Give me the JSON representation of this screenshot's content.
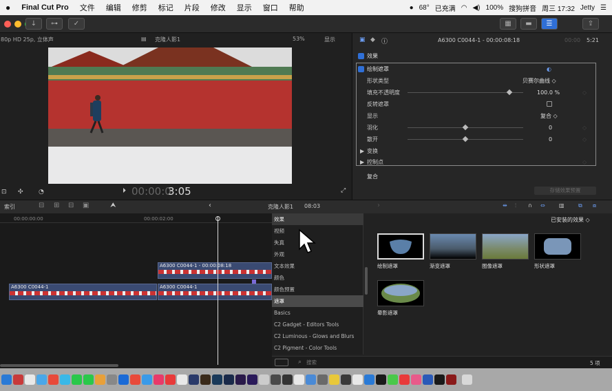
{
  "menubar": {
    "apple": "",
    "app_name": "Final Cut Pro",
    "menus": [
      "文件",
      "编辑",
      "修剪",
      "标记",
      "片段",
      "修改",
      "显示",
      "窗口",
      "帮助"
    ],
    "status": {
      "temp": "68°",
      "charging": "已充满",
      "battery": "100%",
      "input_method": "搜狗拼音",
      "datetime": "周三 17:32",
      "user": "Jetty"
    }
  },
  "viewer": {
    "format": "80p HD 25p, 立体声",
    "project_name": "克隆人影1",
    "zoom": "53%",
    "display_menu": "显示",
    "timecode_dim": "00:00:0",
    "timecode_bright": "3:05"
  },
  "inspector": {
    "clip_title": "A6300 C0044-1 - 00:00:08:18",
    "duration_dim": "00:00",
    "duration_bright": "5:21",
    "section_effects": "效果",
    "effect_name": "绘制遮罩",
    "params": [
      {
        "label": "形状类型",
        "value": "贝赛尔曲线 ◇"
      },
      {
        "label": "填充不透明度",
        "value": "100.0 %",
        "slider": 0.88
      },
      {
        "label": "反转遮罩",
        "value": ""
      },
      {
        "label": "显示",
        "value": "复合 ◇"
      },
      {
        "label": "羽化",
        "value": "0",
        "slider": 0.5
      },
      {
        "label": "散开",
        "value": "0",
        "slider": 0.5
      }
    ],
    "transform": "变换",
    "control_points": "控制点",
    "composite": "复合",
    "save_preset": "存储效果预置"
  },
  "timeline_header": {
    "index": "索引",
    "project_name": "克隆人影1",
    "duration": "08:03"
  },
  "timeline": {
    "ruler": [
      "00:00:00:00",
      "00:00:02:00"
    ],
    "clips": [
      {
        "label": "A6300 C0044-1 - 00:00:08:18"
      },
      {
        "label": "A6300 C0044-1"
      },
      {
        "label": "A6300 C0044-1"
      }
    ]
  },
  "effects_browser": {
    "categories": [
      "效果",
      "视频",
      "失真",
      "外观",
      "文本效果",
      "颜色",
      "颜色预置",
      "遮罩",
      "Basics",
      "C2 Gadget - Editors Tools",
      "C2 Luminous - Glows and Blurs",
      "C2 Pigment - Color Tools"
    ],
    "selected_category": "遮罩",
    "installed_menu": "已安装的效果 ◇",
    "items": [
      "绘制遮罩",
      "渐变遮罩",
      "图像遮罩",
      "形状遮罩",
      "晕影遮罩"
    ],
    "search_placeholder": "搜索",
    "count": "5 项"
  },
  "colors": {
    "accent": "#2f6fd6",
    "background": "#1e1e1e",
    "clip": "#3a4a72"
  }
}
